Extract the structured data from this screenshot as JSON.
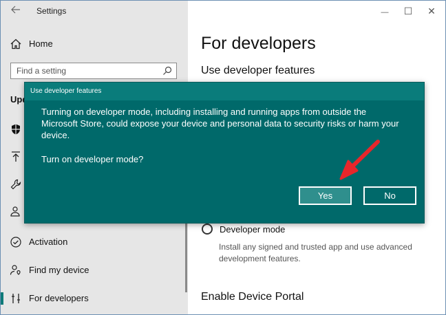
{
  "window": {
    "title": "Settings"
  },
  "window_controls": {
    "minimize": "—",
    "maximize": "☐",
    "close": "✕"
  },
  "sidebar": {
    "home_label": "Home",
    "search_placeholder": "Find a setting",
    "section_label": "Upd",
    "items": [
      {
        "label": "",
        "icon": "shield-icon"
      },
      {
        "label": "",
        "icon": "upload-icon"
      },
      {
        "label": "",
        "icon": "wrench-icon"
      },
      {
        "label": "",
        "icon": "person-sync-icon"
      },
      {
        "label": "Activation",
        "icon": "check-circle-icon"
      },
      {
        "label": "Find my device",
        "icon": "person-location-icon"
      },
      {
        "label": "For developers",
        "icon": "developer-icon"
      }
    ]
  },
  "content": {
    "page_title": "For developers",
    "section_title": "Use developer features",
    "developer_mode_label": "Developer mode",
    "developer_mode_desc": "Install any signed and trusted app and use advanced development features.",
    "device_portal_title": "Enable Device Portal"
  },
  "dialog": {
    "title": "Use developer features",
    "message": "Turning on developer mode, including installing and running apps from outside the Microsoft Store, could expose your device and personal data to security risks or harm your device.",
    "question": "Turn on developer mode?",
    "yes_label": "Yes",
    "no_label": "No"
  },
  "colors": {
    "dialog_bg": "#00696a",
    "accent": "#0e7a78",
    "arrow": "#e8262b"
  }
}
